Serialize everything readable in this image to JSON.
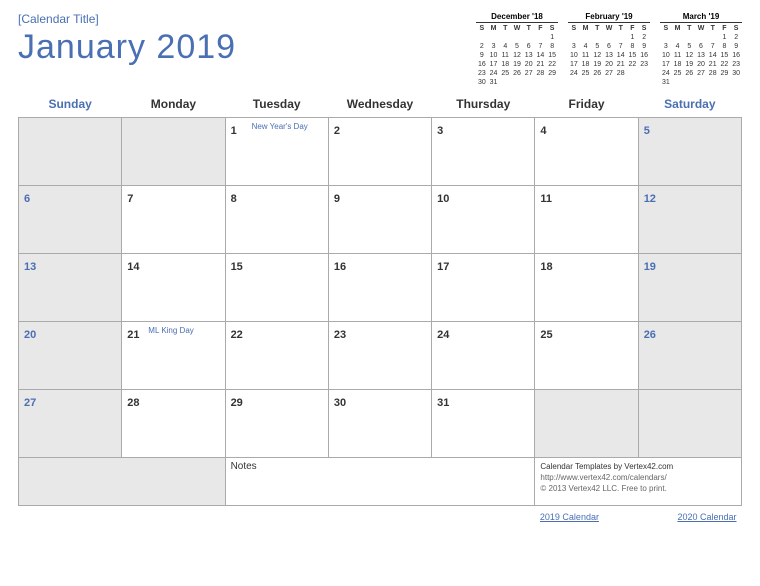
{
  "subtitle_placeholder": "[Calendar Title]",
  "main_title": "January  2019",
  "mini_calendars": [
    {
      "title": "December '18",
      "headers": [
        "S",
        "M",
        "T",
        "W",
        "T",
        "F",
        "S"
      ],
      "cells": [
        "",
        "",
        "",
        "",
        "",
        "",
        "1",
        "2",
        "3",
        "4",
        "5",
        "6",
        "7",
        "8",
        "9",
        "10",
        "11",
        "12",
        "13",
        "14",
        "15",
        "16",
        "17",
        "18",
        "19",
        "20",
        "21",
        "22",
        "23",
        "24",
        "25",
        "26",
        "27",
        "28",
        "29",
        "30",
        "31",
        "",
        "",
        "",
        "",
        ""
      ]
    },
    {
      "title": "February '19",
      "headers": [
        "S",
        "M",
        "T",
        "W",
        "T",
        "F",
        "S"
      ],
      "cells": [
        "",
        "",
        "",
        "",
        "",
        "1",
        "2",
        "3",
        "4",
        "5",
        "6",
        "7",
        "8",
        "9",
        "10",
        "11",
        "12",
        "13",
        "14",
        "15",
        "16",
        "17",
        "18",
        "19",
        "20",
        "21",
        "22",
        "23",
        "24",
        "25",
        "26",
        "27",
        "28",
        "",
        "",
        "",
        "",
        "",
        "",
        "",
        "",
        ""
      ]
    },
    {
      "title": "March '19",
      "headers": [
        "S",
        "M",
        "T",
        "W",
        "T",
        "F",
        "S"
      ],
      "cells": [
        "",
        "",
        "",
        "",
        "",
        "1",
        "2",
        "3",
        "4",
        "5",
        "6",
        "7",
        "8",
        "9",
        "10",
        "11",
        "12",
        "13",
        "14",
        "15",
        "16",
        "17",
        "18",
        "19",
        "20",
        "21",
        "22",
        "23",
        "24",
        "25",
        "26",
        "27",
        "28",
        "29",
        "30",
        "31",
        "",
        "",
        "",
        "",
        "",
        ""
      ]
    }
  ],
  "day_headers": [
    "Sunday",
    "Monday",
    "Tuesday",
    "Wednesday",
    "Thursday",
    "Friday",
    "Saturday"
  ],
  "weeks": [
    [
      {
        "num": "",
        "cls": "out"
      },
      {
        "num": "",
        "cls": "out"
      },
      {
        "num": "1",
        "cls": "",
        "event": "New Year's Day"
      },
      {
        "num": "2",
        "cls": ""
      },
      {
        "num": "3",
        "cls": ""
      },
      {
        "num": "4",
        "cls": ""
      },
      {
        "num": "5",
        "cls": "weekend"
      }
    ],
    [
      {
        "num": "6",
        "cls": "weekend"
      },
      {
        "num": "7",
        "cls": ""
      },
      {
        "num": "8",
        "cls": ""
      },
      {
        "num": "9",
        "cls": ""
      },
      {
        "num": "10",
        "cls": ""
      },
      {
        "num": "11",
        "cls": ""
      },
      {
        "num": "12",
        "cls": "weekend"
      }
    ],
    [
      {
        "num": "13",
        "cls": "weekend"
      },
      {
        "num": "14",
        "cls": ""
      },
      {
        "num": "15",
        "cls": ""
      },
      {
        "num": "16",
        "cls": ""
      },
      {
        "num": "17",
        "cls": ""
      },
      {
        "num": "18",
        "cls": ""
      },
      {
        "num": "19",
        "cls": "weekend"
      }
    ],
    [
      {
        "num": "20",
        "cls": "weekend"
      },
      {
        "num": "21",
        "cls": "",
        "event": "ML King Day"
      },
      {
        "num": "22",
        "cls": ""
      },
      {
        "num": "23",
        "cls": ""
      },
      {
        "num": "24",
        "cls": ""
      },
      {
        "num": "25",
        "cls": ""
      },
      {
        "num": "26",
        "cls": "weekend"
      }
    ],
    [
      {
        "num": "27",
        "cls": "weekend"
      },
      {
        "num": "28",
        "cls": ""
      },
      {
        "num": "29",
        "cls": ""
      },
      {
        "num": "30",
        "cls": ""
      },
      {
        "num": "31",
        "cls": ""
      },
      {
        "num": "",
        "cls": "out"
      },
      {
        "num": "",
        "cls": "out"
      }
    ]
  ],
  "notes_label": "Notes",
  "footer": {
    "line1": "Calendar Templates by Vertex42.com",
    "line2": "http://www.vertex42.com/calendars/",
    "line3": "© 2013 Vertex42 LLC. Free to print."
  },
  "link_prev": "2019 Calendar",
  "link_next": "2020 Calendar"
}
